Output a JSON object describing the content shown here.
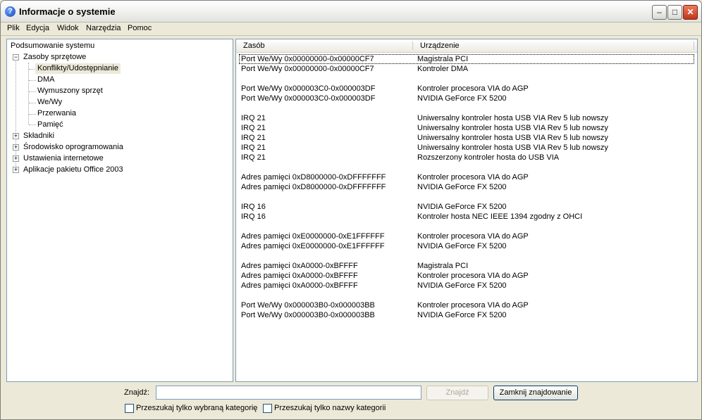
{
  "window": {
    "title": "Informacje o systemie",
    "icon": "help-question-icon"
  },
  "menu": [
    "Plik",
    "Edycja",
    "Widok",
    "Narzędzia",
    "Pomoc"
  ],
  "tree": {
    "root": "Podsumowanie systemu",
    "resources": "Zasoby sprzętowe",
    "resource_children": [
      "Konflikty/Udostępnianie",
      "DMA",
      "Wymuszony sprzęt",
      "We/Wy",
      "Przerwania",
      "Pamięć"
    ],
    "selected": "Konflikty/Udostępnianie",
    "other": [
      "Składniki",
      "Środowisko oprogramowania",
      "Ustawienia internetowe",
      "Aplikacje pakietu Office 2003"
    ]
  },
  "list": {
    "columns": [
      "Zasób",
      "Urządzenie"
    ],
    "rows": [
      [
        "Port We/Wy 0x00000000-0x00000CF7",
        "Magistrala PCI"
      ],
      [
        "Port We/Wy 0x00000000-0x00000CF7",
        "Kontroler DMA"
      ],
      [
        "",
        ""
      ],
      [
        "Port We/Wy 0x000003C0-0x000003DF",
        "Kontroler procesora VIA do AGP"
      ],
      [
        "Port We/Wy 0x000003C0-0x000003DF",
        "NVIDIA GeForce FX 5200"
      ],
      [
        "",
        ""
      ],
      [
        "IRQ 21",
        "Uniwersalny kontroler hosta USB VIA Rev 5 lub nowszy"
      ],
      [
        "IRQ 21",
        "Uniwersalny kontroler hosta USB VIA Rev 5 lub nowszy"
      ],
      [
        "IRQ 21",
        "Uniwersalny kontroler hosta USB VIA Rev 5 lub nowszy"
      ],
      [
        "IRQ 21",
        "Uniwersalny kontroler hosta USB VIA Rev 5 lub nowszy"
      ],
      [
        "IRQ 21",
        "Rozszerzony kontroler hosta do USB VIA"
      ],
      [
        "",
        ""
      ],
      [
        "Adres pamięci 0xD8000000-0xDFFFFFFF",
        "Kontroler procesora VIA do AGP"
      ],
      [
        "Adres pamięci 0xD8000000-0xDFFFFFFF",
        "NVIDIA GeForce FX 5200"
      ],
      [
        "",
        ""
      ],
      [
        "IRQ 16",
        "NVIDIA GeForce FX 5200"
      ],
      [
        "IRQ 16",
        "Kontroler hosta NEC IEEE 1394 zgodny z OHCI"
      ],
      [
        "",
        ""
      ],
      [
        "Adres pamięci 0xE0000000-0xE1FFFFFF",
        "Kontroler procesora VIA do AGP"
      ],
      [
        "Adres pamięci 0xE0000000-0xE1FFFFFF",
        "NVIDIA GeForce FX 5200"
      ],
      [
        "",
        ""
      ],
      [
        "Adres pamięci 0xA0000-0xBFFFF",
        "Magistrala PCI"
      ],
      [
        "Adres pamięci 0xA0000-0xBFFFF",
        "Kontroler procesora VIA do AGP"
      ],
      [
        "Adres pamięci 0xA0000-0xBFFFF",
        "NVIDIA GeForce FX 5200"
      ],
      [
        "",
        ""
      ],
      [
        "Port We/Wy 0x000003B0-0x000003BB",
        "Kontroler procesora VIA do AGP"
      ],
      [
        "Port We/Wy 0x000003B0-0x000003BB",
        "NVIDIA GeForce FX 5200"
      ]
    ]
  },
  "find": {
    "label": "Znajdź:",
    "value": "",
    "find_button": "Znajdź",
    "close_button": "Zamknij znajdowanie",
    "check_category": "Przeszukaj tylko wybraną kategorię",
    "check_names": "Przeszukaj tylko nazwy kategorii"
  }
}
